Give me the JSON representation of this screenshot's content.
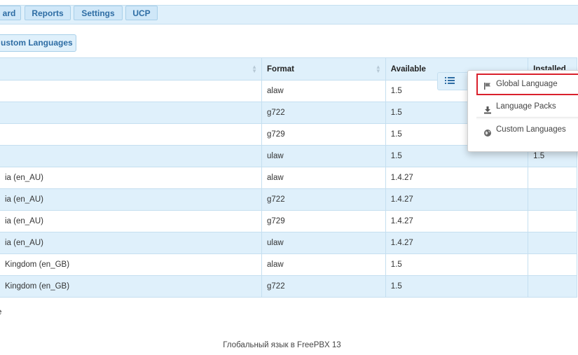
{
  "nav": {
    "tabs": [
      {
        "label": "ard"
      },
      {
        "label": "Reports"
      },
      {
        "label": "Settings"
      },
      {
        "label": "UCP"
      }
    ]
  },
  "custom_button": {
    "label": "ustom Languages"
  },
  "table": {
    "headers": [
      "",
      "Format",
      "Available",
      "Installed"
    ],
    "rows": [
      {
        "language": "",
        "format": "alaw",
        "available": "1.5",
        "installed": ""
      },
      {
        "language": "",
        "format": "g722",
        "available": "1.5",
        "installed": ""
      },
      {
        "language": "",
        "format": "g729",
        "available": "1.5",
        "installed": ""
      },
      {
        "language": "",
        "format": "ulaw",
        "available": "1.5",
        "installed": "1.5"
      },
      {
        "language": "ia (en_AU)",
        "format": "alaw",
        "available": "1.4.27",
        "installed": ""
      },
      {
        "language": "ia (en_AU)",
        "format": "g722",
        "available": "1.4.27",
        "installed": ""
      },
      {
        "language": "ia (en_AU)",
        "format": "g729",
        "available": "1.4.27",
        "installed": ""
      },
      {
        "language": "ia (en_AU)",
        "format": "ulaw",
        "available": "1.4.27",
        "installed": ""
      },
      {
        "language": "Kingdom (en_GB)",
        "format": "alaw",
        "available": "1.5",
        "installed": ""
      },
      {
        "language": "Kingdom (en_GB)",
        "format": "g722",
        "available": "1.5",
        "installed": ""
      }
    ]
  },
  "footnote": "e",
  "caption": "Глобальный язык в FreePBX 13",
  "menu": {
    "items": [
      {
        "label": "Global Language",
        "icon": "flag-icon"
      },
      {
        "label": "Language Packs",
        "icon": "download-icon"
      },
      {
        "label": "Custom Languages",
        "icon": "globe-icon"
      }
    ]
  },
  "colors": {
    "accent": "#2e6da4",
    "row_alt": "#dff0fb",
    "highlight": "#d9202c"
  }
}
